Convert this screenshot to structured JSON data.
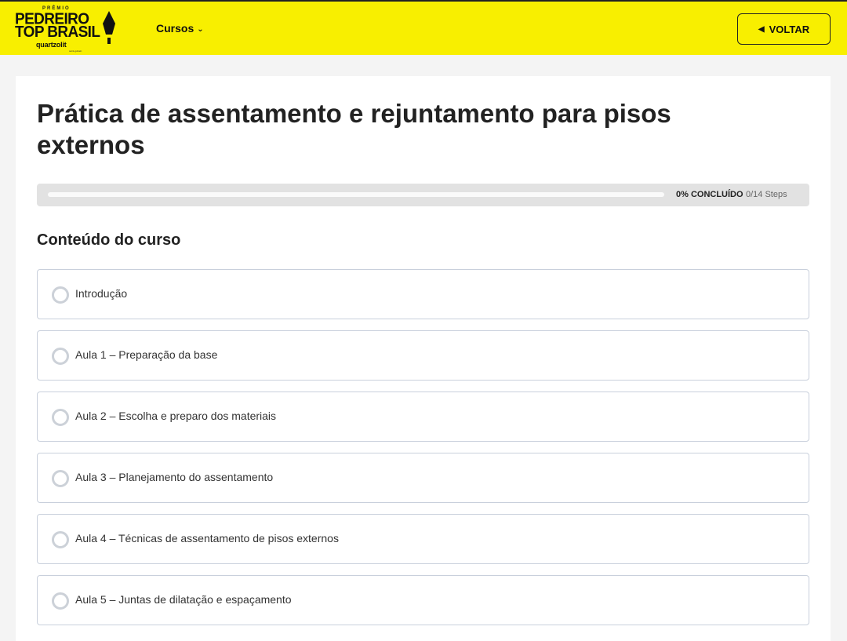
{
  "header": {
    "logo": {
      "premio": "PRÊMIO",
      "line1": "PEDREIRO",
      "line2": "TOP BRASIL",
      "brand": "quartzolit",
      "brand_sub": "saint-gobain"
    },
    "nav_cursos": "Cursos",
    "back_button": "VOLTAR",
    "bg_color": "#f8ef00"
  },
  "course": {
    "title": "Prática de assentamento e rejuntamento para pisos externos",
    "progress": {
      "percent": 0,
      "percent_label": "0% CONCLUÍDO",
      "steps_label": "0/14 Steps"
    },
    "section_title": "Conteúdo do curso",
    "lessons": [
      {
        "label": "Introdução",
        "completed": false
      },
      {
        "label": "Aula 1 – Preparação da base",
        "completed": false
      },
      {
        "label": "Aula 2 – Escolha e preparo dos materiais",
        "completed": false
      },
      {
        "label": "Aula 3 – Planejamento do assentamento",
        "completed": false
      },
      {
        "label": "Aula 4 – Técnicas de assentamento de pisos externos",
        "completed": false
      },
      {
        "label": "Aula 5 – Juntas de dilatação e espaçamento",
        "completed": false
      }
    ]
  }
}
